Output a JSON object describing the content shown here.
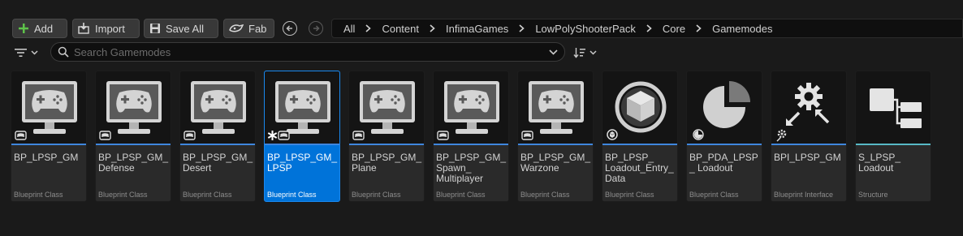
{
  "toolbar": {
    "add_label": "Add",
    "import_label": "Import",
    "save_all_label": "Save All",
    "fab_label": "Fab"
  },
  "breadcrumb": [
    "All",
    "Content",
    "InfimaGames",
    "LowPolyShooterPack",
    "Core",
    "Gamemodes"
  ],
  "search": {
    "placeholder": "Search Gamemodes"
  },
  "colors": {
    "accent_blue": "#3f86de",
    "structure_cyan": "#58b9c6",
    "selection": "#0073d9",
    "add_icon_green": "#5ec24a"
  },
  "assets": [
    {
      "name": "BP_LPSP_GM",
      "type": "Blueprint Class",
      "icon": "gamepad-monitor-icon",
      "selected": false
    },
    {
      "name": "BP_LPSP_GM_ Defense",
      "type": "Blueprint Class",
      "icon": "gamepad-monitor-icon",
      "selected": false
    },
    {
      "name": "BP_LPSP_GM_ Desert",
      "type": "Blueprint Class",
      "icon": "gamepad-monitor-icon",
      "selected": false
    },
    {
      "name": "BP_LPSP_GM_ LPSP",
      "type": "Blueprint Class",
      "icon": "gamepad-monitor-icon",
      "selected": true,
      "modified": true
    },
    {
      "name": "BP_LPSP_GM_ Plane",
      "type": "Blueprint Class",
      "icon": "gamepad-monitor-icon",
      "selected": false
    },
    {
      "name": "BP_LPSP_GM_ Spawn_ Multiplayer",
      "type": "Blueprint Class",
      "icon": "gamepad-monitor-icon",
      "selected": false
    },
    {
      "name": "BP_LPSP_GM_ Warzone",
      "type": "Blueprint Class",
      "icon": "gamepad-monitor-icon",
      "selected": false
    },
    {
      "name": "BP_LPSP_ Loadout_Entry_ Data",
      "type": "Blueprint Class",
      "icon": "cube-sphere-icon",
      "selected": false
    },
    {
      "name": "BP_PDA_LPSP_ Loadout",
      "type": "Blueprint Class",
      "icon": "pie-chart-icon",
      "selected": false
    },
    {
      "name": "BPI_LPSP_GM",
      "type": "Blueprint Interface",
      "icon": "interface-gear-icon",
      "selected": false
    },
    {
      "name": "S_LPSP_ Loadout",
      "type": "Structure",
      "icon": "structure-icon",
      "selected": false
    }
  ]
}
